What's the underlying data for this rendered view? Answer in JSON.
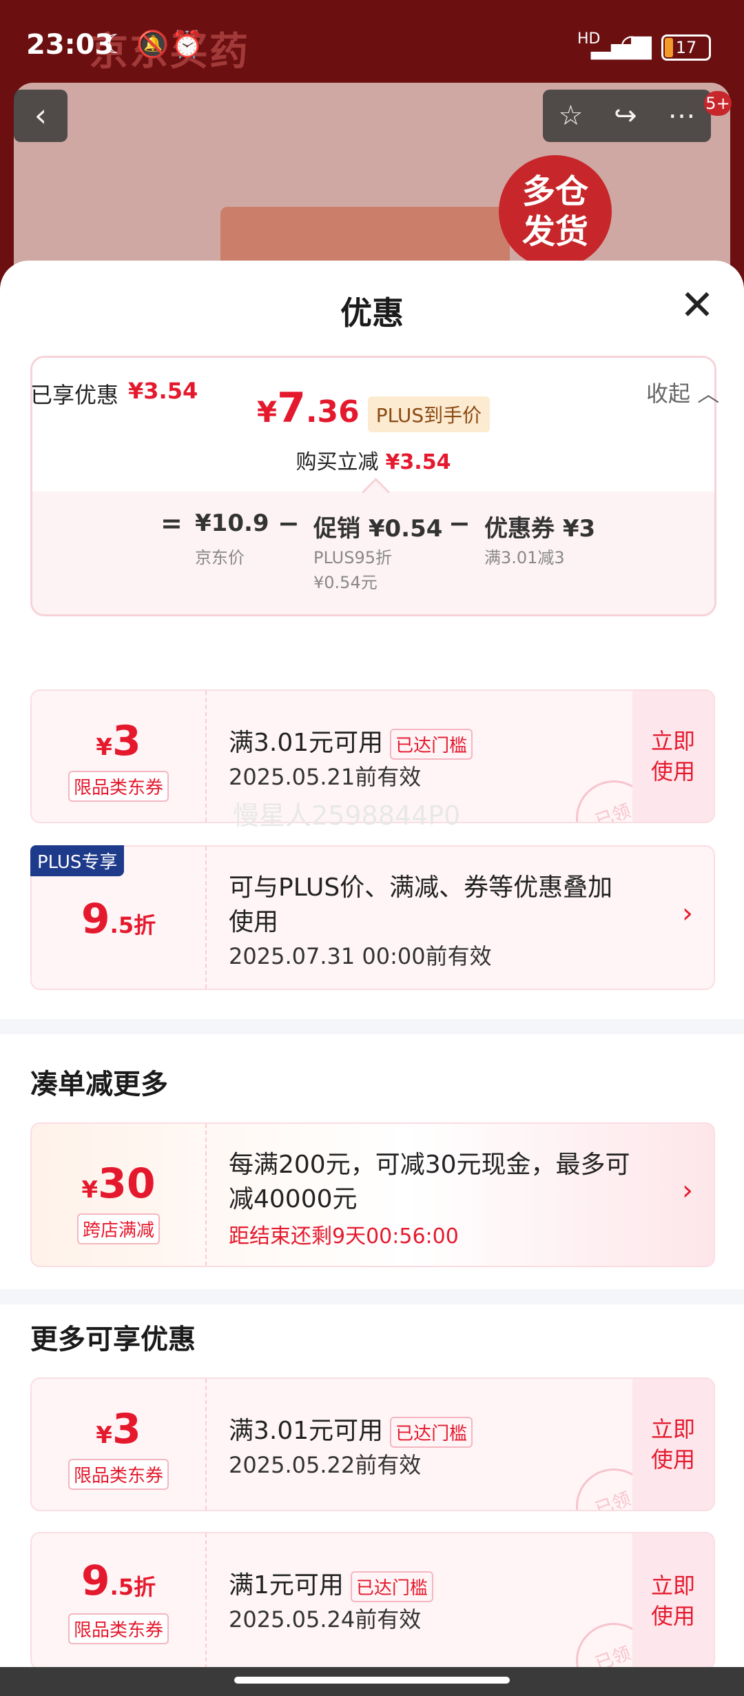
{
  "status_bar": {
    "time": "23:03",
    "battery": "17",
    "network": "HD"
  },
  "background": {
    "title": "京东买药",
    "badge": "多仓\n发货",
    "badge_line1": "多仓",
    "badge_line2": "发货",
    "notification_count": "5+"
  },
  "sheet": {
    "title": "优惠"
  },
  "summary": {
    "yen": "¥",
    "price_int": "7",
    "price_dec": ".36",
    "plus_tag": "PLUS到手价",
    "reduce_label": "购买立减",
    "reduce_value": "¥3.54",
    "calc": {
      "eq": "=",
      "jd_price": "¥10.9",
      "jd_price_label": "京东价",
      "minus1": "−",
      "promo": "促销 ¥0.54",
      "promo_sub1": "PLUS95折",
      "promo_sub2": "¥0.54元",
      "minus2": "−",
      "coupon": "优惠券 ¥3",
      "coupon_sub": "满3.01减3"
    }
  },
  "enjoyed": {
    "label": "已享优惠",
    "value": "¥3.54",
    "collapse": "收起"
  },
  "coupons_enjoyed": [
    {
      "yen": "¥",
      "amount": "3",
      "suffix": "",
      "tag": "限品类东券",
      "desc": "满3.01元可用",
      "reached": "已达门槛",
      "date": "2025.05.21前有效",
      "action": "立即使用"
    },
    {
      "corner": "PLUS专享",
      "yen": "",
      "amount": "9",
      "suffix": ".5折",
      "desc_line1": "可与PLUS价、满减、券等优惠叠加",
      "desc_line2": "使用",
      "date": "2025.07.31 00:00前有效"
    }
  ],
  "watermark": "慢星人2598844P0",
  "section_more_order": {
    "title": "凑单减更多",
    "card": {
      "yen": "¥",
      "amount": "30",
      "tag": "跨店满减",
      "desc_line1": "每满200元，可减30元现金，最多可",
      "desc_line2": "减40000元",
      "countdown": "距结束还剩9天00:56:00"
    }
  },
  "section_more_discounts": {
    "title": "更多可享优惠",
    "coupons": [
      {
        "yen": "¥",
        "amount": "3",
        "suffix": "",
        "tag": "限品类东券",
        "desc": "满3.01元可用",
        "reached": "已达门槛",
        "date": "2025.05.22前有效",
        "action": "立即使用"
      },
      {
        "yen": "",
        "amount": "9",
        "suffix": ".5折",
        "tag": "限品类东券",
        "desc": "满1元可用",
        "reached": "已达门槛",
        "date": "2025.05.24前有效",
        "action": "立即使用"
      }
    ]
  },
  "stamp_text": "已领",
  "colors": {
    "accent_red": "#e5192d",
    "plus_blue": "#1e3a8a",
    "coupon_bg": "#fff5f6"
  }
}
